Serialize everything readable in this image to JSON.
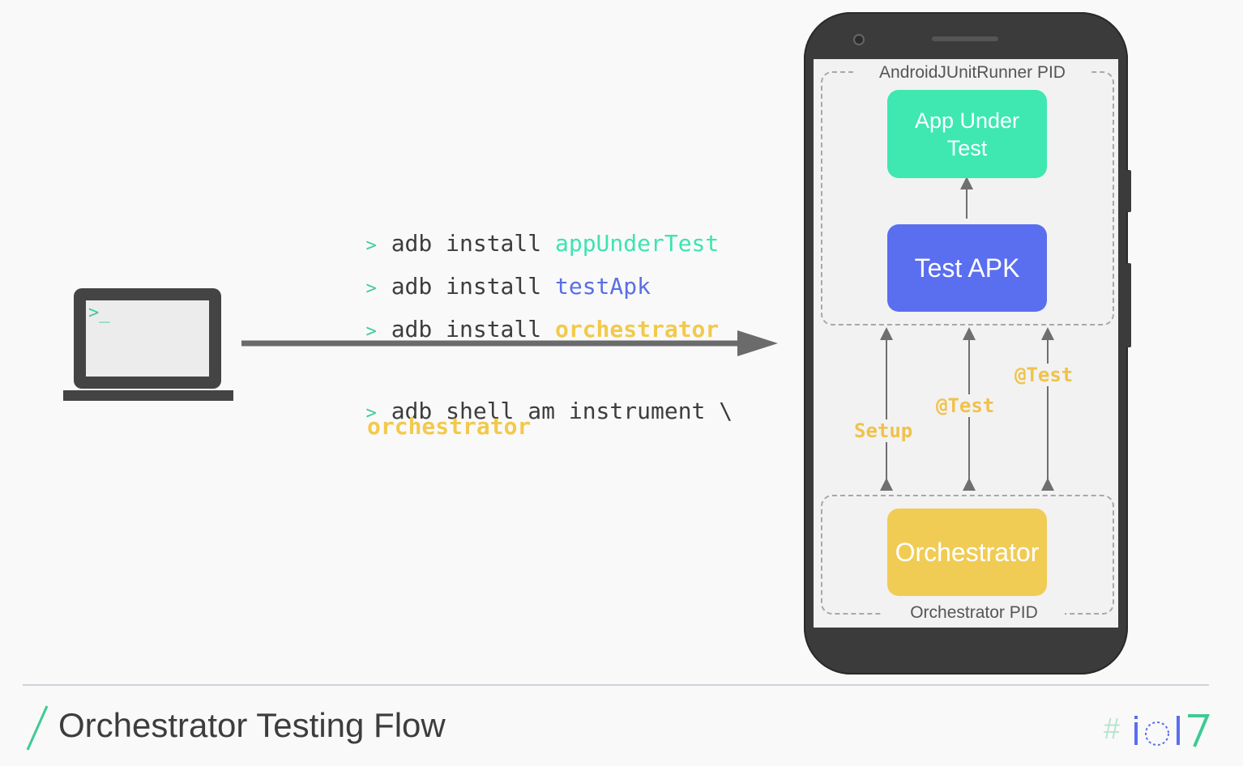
{
  "slide": {
    "title": "Orchestrator Testing Flow",
    "accent_color": "#3ecb93",
    "logo_icon": "io17-logo"
  },
  "terminal": {
    "icon": "laptop-terminal-icon",
    "prompt": ">_"
  },
  "commands": {
    "prompt": ">",
    "install": [
      {
        "cmd": "adb install",
        "arg": "appUnderTest",
        "arg_color": "#3ee3b0"
      },
      {
        "cmd": "adb install",
        "arg": "testApk",
        "arg_color": "#5a6ee6"
      },
      {
        "cmd": "adb install",
        "arg": "orchestrator",
        "arg_color": "#f2c94c"
      }
    ],
    "shell_line": "adb shell am instrument \\",
    "shell_arg": "orchestrator"
  },
  "phone": {
    "runner_pid_label": "AndroidJUnitRunner PID",
    "orchestrator_pid_label": "Orchestrator PID",
    "app_under_test": "App Under Test",
    "test_apk": "Test APK",
    "orchestrator": "Orchestrator",
    "colors": {
      "app_under_test": "#3ee8b0",
      "test_apk": "#5a6ef0",
      "orchestrator": "#f0cc55"
    }
  },
  "flows": {
    "setup": "Setup",
    "test1": "@Test",
    "test2": "@Test"
  }
}
